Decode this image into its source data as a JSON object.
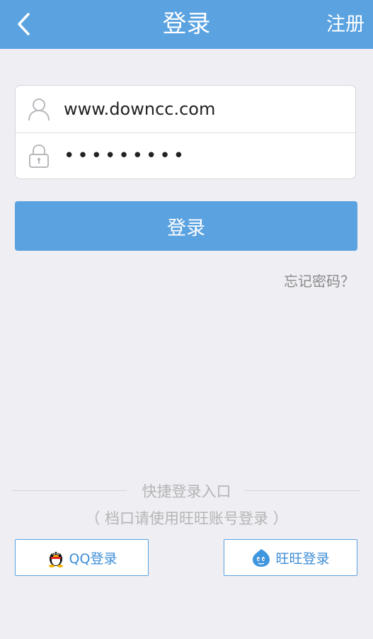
{
  "header": {
    "back_icon": "chevron-left-icon",
    "title": "登录",
    "register_label": "注册",
    "color": "#5aa2e0"
  },
  "form": {
    "username_value": "www.downcc.com",
    "password_value": "•••••••••",
    "user_icon": "user-icon",
    "lock_icon": "lock-icon"
  },
  "login_button_label": "登录",
  "forgot_password": "忘记密码？",
  "quick_login": {
    "title": "快捷登录入口",
    "note": "（ 档口请使用旺旺账号登录 ）",
    "qq_label": "QQ登录",
    "wangwang_label": "旺旺登录"
  }
}
